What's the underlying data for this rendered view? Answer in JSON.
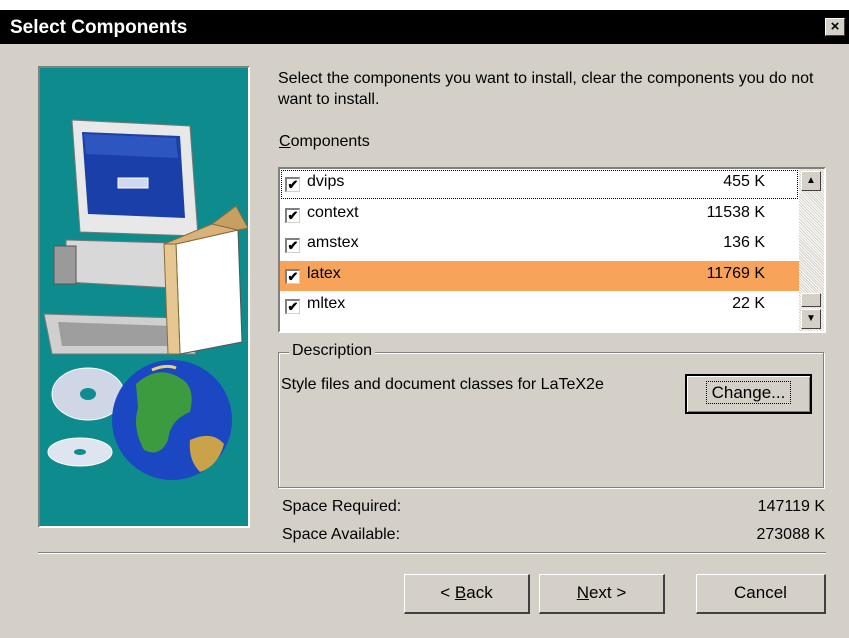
{
  "window": {
    "title": "Select Components",
    "close_symbol": "×"
  },
  "intro_text": "Select the components you want to install, clear the components you do not want to install.",
  "components": {
    "label_accel": "C",
    "label_rest": "omponents",
    "items": [
      {
        "name": "dvips",
        "size": "455 K",
        "checked": true,
        "selected": false
      },
      {
        "name": "context",
        "size": "11538 K",
        "checked": true,
        "selected": false
      },
      {
        "name": "amstex",
        "size": "136 K",
        "checked": true,
        "selected": false
      },
      {
        "name": "latex",
        "size": "11769 K",
        "checked": true,
        "selected": true
      },
      {
        "name": "mltex",
        "size": "22 K",
        "checked": true,
        "selected": false
      }
    ],
    "check_symbol": "✔",
    "highlight_color": "#f7a35a"
  },
  "description": {
    "legend": "Description",
    "text": "Style files and document classes for LaTeX2e",
    "change_label": "Change..."
  },
  "space": {
    "required_label": "Space Required:",
    "required_value": "147119 K",
    "available_label": "Space Available:",
    "available_value": "273088 K"
  },
  "buttons": {
    "back_prefix": "< ",
    "back_accel": "B",
    "back_rest": "ack",
    "next_accel": "N",
    "next_rest": "ext >",
    "cancel": "Cancel"
  },
  "icons": {
    "close": "close-icon",
    "scroll_up": "arrow-up-icon",
    "scroll_down": "arrow-down-icon",
    "illustration": "computer-and-globe-illustration"
  },
  "colors": {
    "dialog": "#d4d0c8",
    "title_bar": "#000000",
    "art_panel": "#0e8b8d"
  }
}
